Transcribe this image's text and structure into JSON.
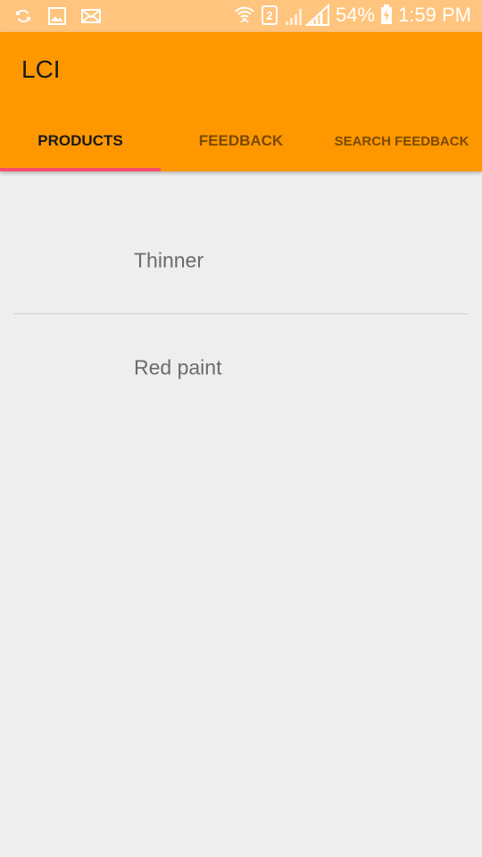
{
  "status_bar": {
    "left_icons": [
      "sync-icon",
      "image-icon",
      "mail-icon"
    ],
    "right_icons": [
      "wifi-icon",
      "sim-2-icon",
      "signal-icon",
      "charging-battery-icon"
    ],
    "battery": "54%",
    "time": "1:59 PM"
  },
  "app_bar": {
    "title": "LCI",
    "background": "#ff9800"
  },
  "tabs": [
    {
      "label": "PRODUCTS",
      "active": true
    },
    {
      "label": "FEEDBACK",
      "active": false
    },
    {
      "label": "SEARCH FEEDBACK",
      "active": false
    }
  ],
  "tab_indicator_color": "#ff4f6e",
  "products": [
    {
      "name": "Thinner"
    },
    {
      "name": "Red paint"
    }
  ]
}
